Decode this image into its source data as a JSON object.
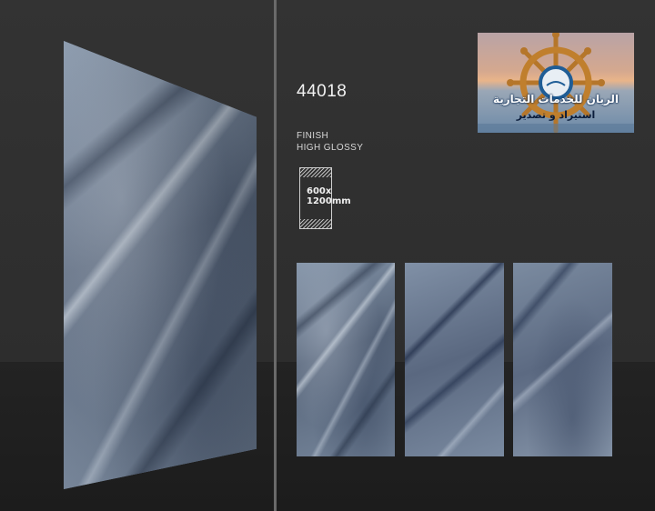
{
  "product": {
    "code": "44018",
    "finish_label": "FINISH",
    "finish_value": "HIGH GLOSSY",
    "size_line1": "600x",
    "size_line2": "1200mm"
  },
  "logo": {
    "line1": "الريان للخدمات التجارية",
    "line2": "استيراد و تصدير"
  },
  "colors": {
    "background": "#2f2f2f",
    "divider": "#6a6a6a",
    "marble_base": "#5e6c80",
    "logo_text": "#0b2a52"
  }
}
